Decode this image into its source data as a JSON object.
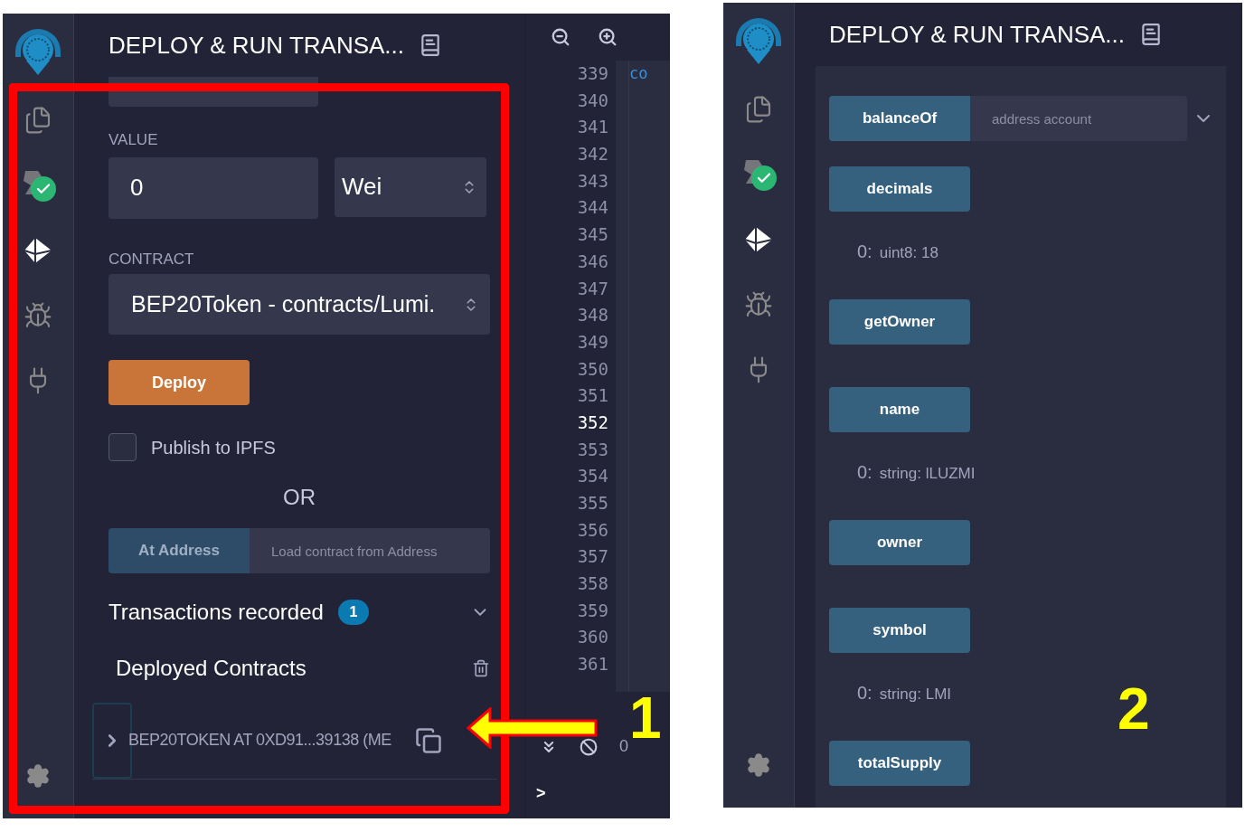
{
  "sidebar_items": [
    {
      "kind": "files",
      "selected": false
    },
    {
      "kind": "compiler",
      "selected": false
    },
    {
      "kind": "deploy",
      "selected": true
    },
    {
      "kind": "debugger",
      "selected": false
    },
    {
      "kind": "plugins",
      "selected": false
    }
  ],
  "left_screen": {
    "panel_title": "DEPLOY & RUN TRANSA...",
    "value_label": "VALUE",
    "value": "0",
    "unit": "Wei",
    "contract_label": "CONTRACT",
    "contract": "BEP20Token - contracts/Lumi.",
    "deploy_button": "Deploy",
    "publish": {
      "label": "Publish to IPFS",
      "checked": false
    },
    "or_text": "OR",
    "at_address_button": "At Address",
    "address_field": {
      "placeholder": "Load contract from Address"
    },
    "transactions": {
      "label": "Transactions recorded",
      "count": "1",
      "expanded": false
    },
    "deployed_title": "Deployed Contracts",
    "deployed_contracts": [
      {
        "label": "BEP20TOKEN AT 0XD91...39138 (ME",
        "expanded": false
      }
    ],
    "editor": {
      "code_fragment": "co",
      "lines": [
        {
          "number": "339",
          "selected": false
        },
        {
          "number": "340",
          "selected": false
        },
        {
          "number": "341",
          "selected": false
        },
        {
          "number": "342",
          "selected": false
        },
        {
          "number": "343",
          "selected": false
        },
        {
          "number": "344",
          "selected": false
        },
        {
          "number": "345",
          "selected": false
        },
        {
          "number": "346",
          "selected": false
        },
        {
          "number": "347",
          "selected": false
        },
        {
          "number": "348",
          "selected": false
        },
        {
          "number": "349",
          "selected": false
        },
        {
          "number": "350",
          "selected": false
        },
        {
          "number": "351",
          "selected": false
        },
        {
          "number": "352",
          "selected": true
        },
        {
          "number": "353",
          "selected": false
        },
        {
          "number": "354",
          "selected": false
        },
        {
          "number": "355",
          "selected": false
        },
        {
          "number": "356",
          "selected": false
        },
        {
          "number": "357",
          "selected": false
        },
        {
          "number": "358",
          "selected": false
        },
        {
          "number": "359",
          "selected": false
        },
        {
          "number": "360",
          "selected": false
        },
        {
          "number": "361",
          "selected": false
        }
      ],
      "terminal_count": "0",
      "terminal_prompt": ">"
    },
    "callout": "1"
  },
  "right_screen": {
    "panel_title": "DEPLOY & RUN TRANSA...",
    "functions": [
      {
        "name": "balanceOf",
        "kind": "input",
        "placeholder": "address account"
      },
      {
        "name": "decimals",
        "kind": "call",
        "output_index": "0:",
        "output": "uint8: 18"
      },
      {
        "name": "getOwner",
        "kind": "call"
      },
      {
        "name": "name",
        "kind": "call",
        "output_index": "0:",
        "output": "string: lLUZMI"
      },
      {
        "name": "owner",
        "kind": "call"
      },
      {
        "name": "symbol",
        "kind": "call",
        "output_index": "0:",
        "output": "string: LMI"
      },
      {
        "name": "totalSupply",
        "kind": "call"
      }
    ],
    "callout": "2"
  }
}
